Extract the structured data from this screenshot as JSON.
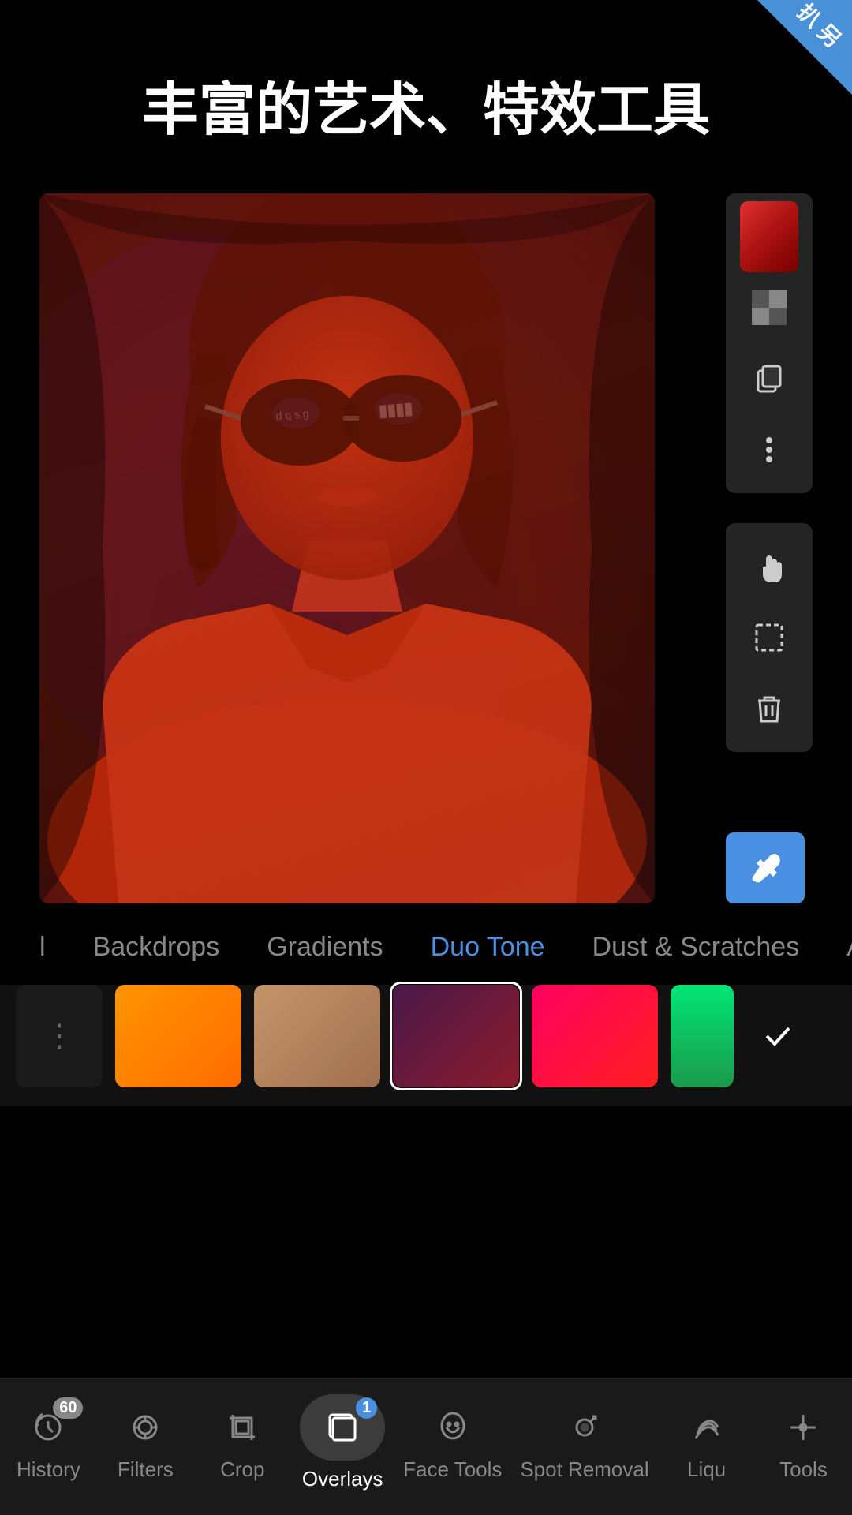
{
  "header": {
    "title": "丰富的艺术、特效工具"
  },
  "corner_badge": {
    "text": "扒 另"
  },
  "toolbar": {
    "buttons": [
      {
        "name": "hand-icon",
        "label": "Hand"
      },
      {
        "name": "selection-icon",
        "label": "Selection"
      },
      {
        "name": "delete-icon",
        "label": "Delete"
      }
    ]
  },
  "categories": {
    "items": [
      {
        "id": "cat-1",
        "label": "l",
        "active": false
      },
      {
        "id": "cat-backdrops",
        "label": "Backdrops",
        "active": false
      },
      {
        "id": "cat-gradients",
        "label": "Gradients",
        "active": false
      },
      {
        "id": "cat-duotone",
        "label": "Duo Tone",
        "active": true
      },
      {
        "id": "cat-dust",
        "label": "Dust & Scratches",
        "active": false
      },
      {
        "id": "cat-all",
        "label": "All",
        "active": false
      }
    ]
  },
  "swatches": [
    {
      "id": "s0",
      "type": "more",
      "label": "⋮"
    },
    {
      "id": "s1",
      "color1": "#FF9500",
      "color2": "#FF6B00",
      "type": "gradient"
    },
    {
      "id": "s2",
      "color1": "#C4956A",
      "color2": "#A07050",
      "type": "gradient"
    },
    {
      "id": "s3",
      "color1": "#4a1a4a",
      "color2": "#8a1a2a",
      "type": "gradient",
      "selected": true
    },
    {
      "id": "s4",
      "color1": "#FF0060",
      "color2": "#FF2020",
      "type": "gradient"
    },
    {
      "id": "s5",
      "color1": "#00E676",
      "color2": "#1a9a4a",
      "type": "gradient"
    }
  ],
  "bottom_nav": {
    "items": [
      {
        "id": "nav-history",
        "label": "History",
        "icon": "history",
        "badge": "60",
        "active": false
      },
      {
        "id": "nav-filters",
        "label": "Filters",
        "icon": "filters",
        "badge": null,
        "active": false
      },
      {
        "id": "nav-crop",
        "label": "Crop",
        "icon": "crop",
        "badge": null,
        "active": false
      },
      {
        "id": "nav-overlays",
        "label": "Overlays",
        "icon": "overlays",
        "badge": "1",
        "active": true
      },
      {
        "id": "nav-facetools",
        "label": "Face Tools",
        "icon": "face",
        "badge": null,
        "active": false
      },
      {
        "id": "nav-spotremoval",
        "label": "Spot Removal",
        "icon": "spot",
        "badge": null,
        "active": false
      },
      {
        "id": "nav-liqu",
        "label": "Liqu",
        "icon": "liqu",
        "badge": null,
        "active": false
      },
      {
        "id": "nav-tools",
        "label": "Tools",
        "icon": "tools",
        "badge": null,
        "active": false
      }
    ]
  }
}
